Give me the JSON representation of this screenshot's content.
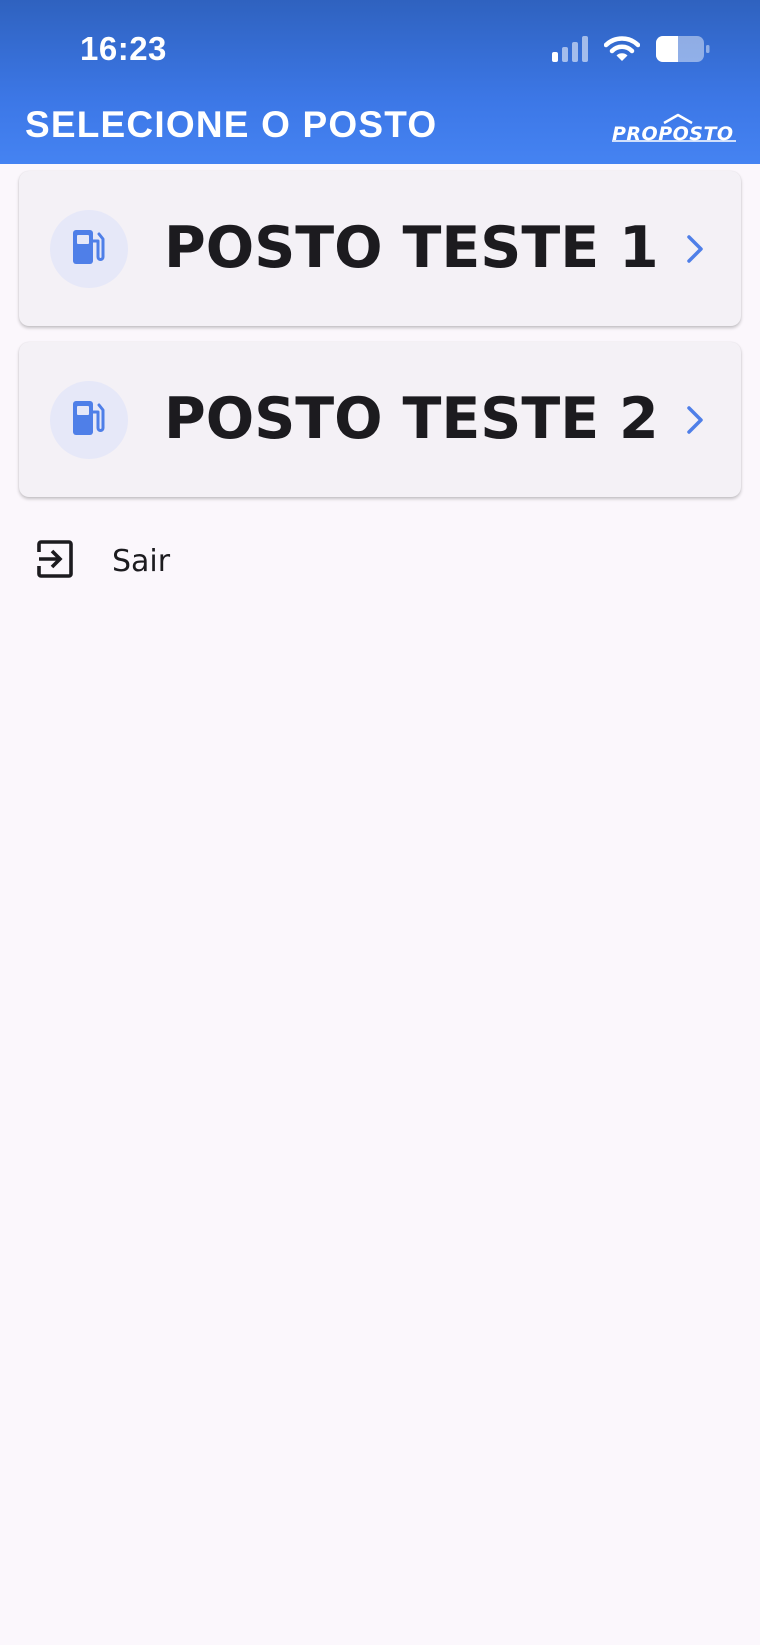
{
  "status_bar": {
    "time": "16:23",
    "icons": [
      "cellular-signal-icon",
      "wifi-icon",
      "battery-icon"
    ]
  },
  "header": {
    "title": "SELECIONE O POSTO",
    "logo": "proposto-logo"
  },
  "stations": [
    {
      "name": "POSTO TESTE 1",
      "icon": "fuel-pump-icon"
    },
    {
      "name": "POSTO TESTE 2",
      "icon": "fuel-pump-icon"
    }
  ],
  "logout": {
    "label": "Sair",
    "icon": "logout-icon"
  },
  "colors": {
    "header_gradient_top": "#2F62BF",
    "header_gradient_bottom": "#4583F2",
    "background": "#FBF7FC",
    "card_background": "#F4F1F6",
    "icon_circle": "#E6E8F8",
    "accent_blue": "#4F7FE8",
    "text_primary": "#1C1B1F"
  }
}
